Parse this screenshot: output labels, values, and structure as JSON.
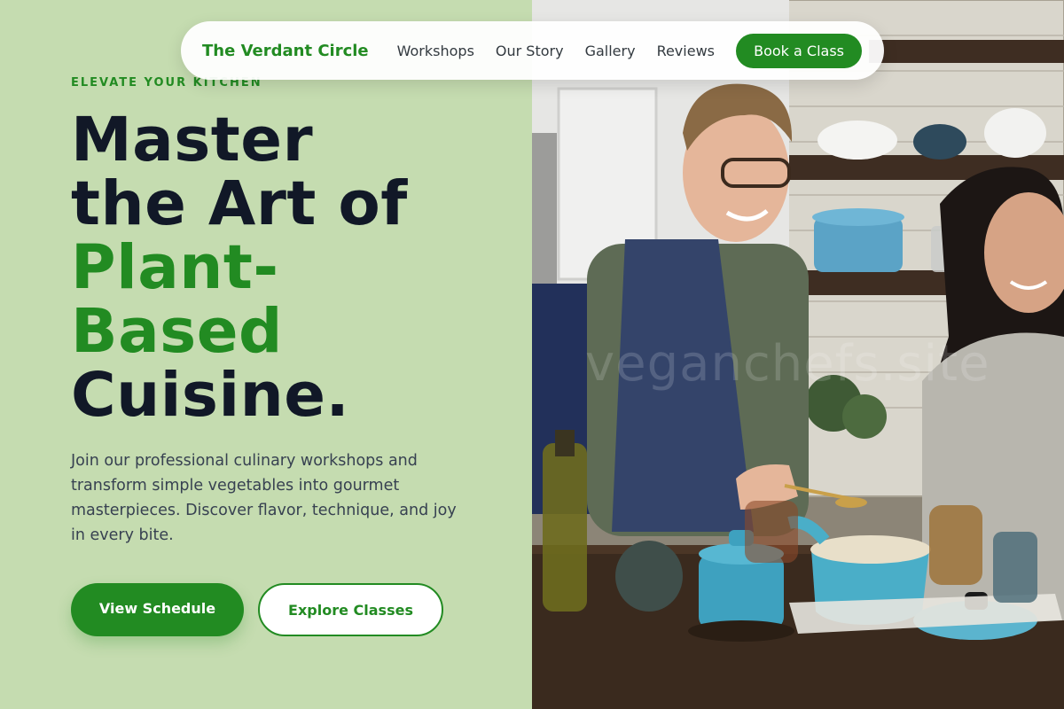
{
  "nav": {
    "brand": "The Verdant Circle",
    "links": [
      "Workshops",
      "Our Story",
      "Gallery",
      "Reviews"
    ],
    "cta": "Book a Class"
  },
  "hero": {
    "eyebrow": "ELEVATE YOUR KITCHEN",
    "headline_lines": [
      "Master",
      "the Art of",
      "Plant-",
      "Based",
      "Cuisine."
    ],
    "subtext": "Join our professional culinary workshops and transform simple vegetables into gourmet masterpieces. Discover flavor, technique, and joy in every bite.",
    "primary_button": "View Schedule",
    "secondary_button": "Explore Classes"
  },
  "photo": {
    "watermark": "veganchefs.site"
  },
  "colors": {
    "accent": "#228b22",
    "left_background": "#c5dcb0",
    "headline_dark": "#111827"
  }
}
